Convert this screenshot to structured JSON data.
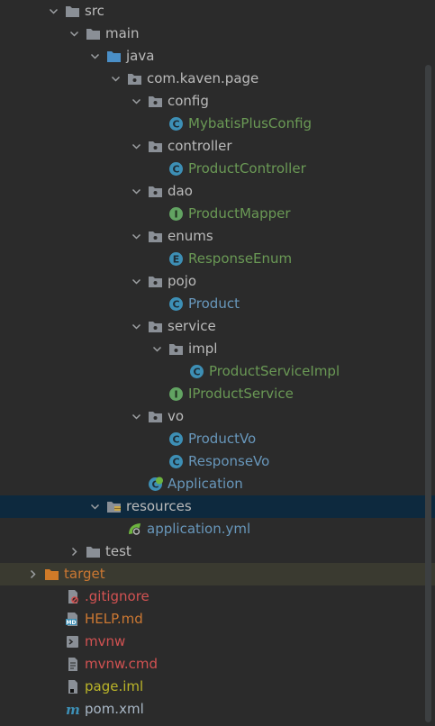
{
  "tree": [
    {
      "label": "src",
      "depth": 1,
      "kind": "folder",
      "expanded": true,
      "color": "#bbbbbb"
    },
    {
      "label": "main",
      "depth": 2,
      "kind": "folder",
      "expanded": true,
      "color": "#bbbbbb"
    },
    {
      "label": "java",
      "depth": 3,
      "kind": "folder-blue",
      "expanded": true,
      "color": "#bbbbbb"
    },
    {
      "label": "com.kaven.page",
      "depth": 4,
      "kind": "package",
      "expanded": true,
      "color": "#bbbbbb"
    },
    {
      "label": "config",
      "depth": 5,
      "kind": "package",
      "expanded": true,
      "color": "#bbbbbb"
    },
    {
      "label": "MybatisPlusConfig",
      "depth": 6,
      "kind": "class-c",
      "color": "#6a9955"
    },
    {
      "label": "controller",
      "depth": 5,
      "kind": "package",
      "expanded": true,
      "color": "#bbbbbb"
    },
    {
      "label": "ProductController",
      "depth": 6,
      "kind": "class-c",
      "color": "#6a9955"
    },
    {
      "label": "dao",
      "depth": 5,
      "kind": "package",
      "expanded": true,
      "color": "#bbbbbb"
    },
    {
      "label": "ProductMapper",
      "depth": 6,
      "kind": "class-i",
      "color": "#6a9955"
    },
    {
      "label": "enums",
      "depth": 5,
      "kind": "package",
      "expanded": true,
      "color": "#bbbbbb"
    },
    {
      "label": "ResponseEnum",
      "depth": 6,
      "kind": "class-e",
      "color": "#6a9955"
    },
    {
      "label": "pojo",
      "depth": 5,
      "kind": "package",
      "expanded": true,
      "color": "#bbbbbb"
    },
    {
      "label": "Product",
      "depth": 6,
      "kind": "class-c",
      "color": "#6897bb"
    },
    {
      "label": "service",
      "depth": 5,
      "kind": "package",
      "expanded": true,
      "color": "#bbbbbb"
    },
    {
      "label": "impl",
      "depth": 6,
      "kind": "package",
      "expanded": true,
      "color": "#bbbbbb"
    },
    {
      "label": "ProductServiceImpl",
      "depth": 7,
      "kind": "class-c",
      "color": "#6a9955"
    },
    {
      "label": "IProductService",
      "depth": 6,
      "kind": "class-i",
      "color": "#6a9955"
    },
    {
      "label": "vo",
      "depth": 5,
      "kind": "package",
      "expanded": true,
      "color": "#bbbbbb"
    },
    {
      "label": "ProductVo",
      "depth": 6,
      "kind": "class-c",
      "color": "#6897bb"
    },
    {
      "label": "ResponseVo",
      "depth": 6,
      "kind": "class-c",
      "color": "#6897bb"
    },
    {
      "label": "Application",
      "depth": 5,
      "kind": "spring-app",
      "color": "#6897bb"
    },
    {
      "label": "resources",
      "depth": 3,
      "kind": "folder-res",
      "expanded": true,
      "selected": true,
      "color": "#bbbbbb"
    },
    {
      "label": "application.yml",
      "depth": 4,
      "kind": "spring-yml",
      "color": "#6897bb"
    },
    {
      "label": "test",
      "depth": 2,
      "kind": "folder",
      "expanded": false,
      "color": "#bbbbbb"
    },
    {
      "label": "target",
      "depth": 0,
      "kind": "folder-orange",
      "expanded": false,
      "excluded": true,
      "color": "#cc7832"
    },
    {
      "label": ".gitignore",
      "depth": 1,
      "kind": "file-ignore",
      "color": "#d25252"
    },
    {
      "label": "HELP.md",
      "depth": 1,
      "kind": "file-md",
      "color": "#cc7832"
    },
    {
      "label": "mvnw",
      "depth": 1,
      "kind": "file-shell",
      "color": "#d25252"
    },
    {
      "label": "mvnw.cmd",
      "depth": 1,
      "kind": "file-text",
      "color": "#d25252"
    },
    {
      "label": "page.iml",
      "depth": 1,
      "kind": "file-iml",
      "color": "#bbb529"
    },
    {
      "label": "pom.xml",
      "depth": 1,
      "kind": "file-maven",
      "color": "#a9b7c6"
    }
  ]
}
